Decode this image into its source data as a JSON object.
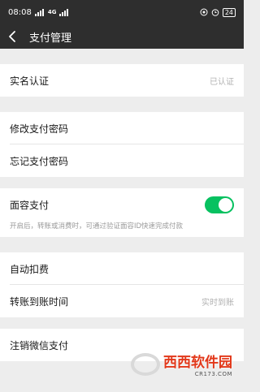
{
  "status_bar": {
    "time": "08:08",
    "battery": "24"
  },
  "nav": {
    "title": "支付管理"
  },
  "sections": {
    "identity": {
      "label": "实名认证",
      "value": "已认证"
    },
    "password": {
      "change_label": "修改支付密码",
      "forgot_label": "忘记支付密码"
    },
    "face_pay": {
      "label": "面容支付",
      "enabled": true,
      "hint": "开启后，转账或消费时，可通过验证面容ID快速完成付款"
    },
    "auto": {
      "auto_deduct_label": "自动扣费",
      "transfer_time_label": "转账到账时间",
      "transfer_time_value": "实时到账"
    },
    "cancel": {
      "label": "注销微信支付"
    }
  },
  "watermark": {
    "main": "西西软件园",
    "sub": "CR173.COM"
  },
  "colors": {
    "accent": "#07c160",
    "header": "#2e2e2e"
  }
}
